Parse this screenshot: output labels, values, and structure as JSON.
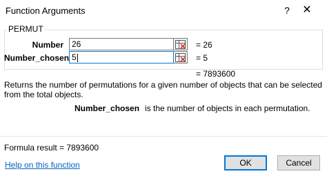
{
  "window": {
    "title": "Function Arguments",
    "help_glyph": "?",
    "close_glyph": "✕"
  },
  "function": {
    "name": "PERMUT",
    "args": [
      {
        "label": "Number",
        "value": "26",
        "evaluated": "= 26"
      },
      {
        "label": "Number_chosen",
        "value": "5",
        "evaluated": "= 5"
      }
    ],
    "result_preview": "= 7893600",
    "description": "Returns the number of permutations for a given number of objects that can be selected from the total objects.",
    "arg_help": {
      "name": "Number_chosen",
      "text": "is the number of objects in each permutation."
    }
  },
  "footer": {
    "formula_result": "Formula result =   7893600",
    "help_link": "Help on this function",
    "ok_label": "OK",
    "cancel_label": "Cancel"
  },
  "colors": {
    "accent": "#0078d7",
    "link": "#0563c1"
  }
}
